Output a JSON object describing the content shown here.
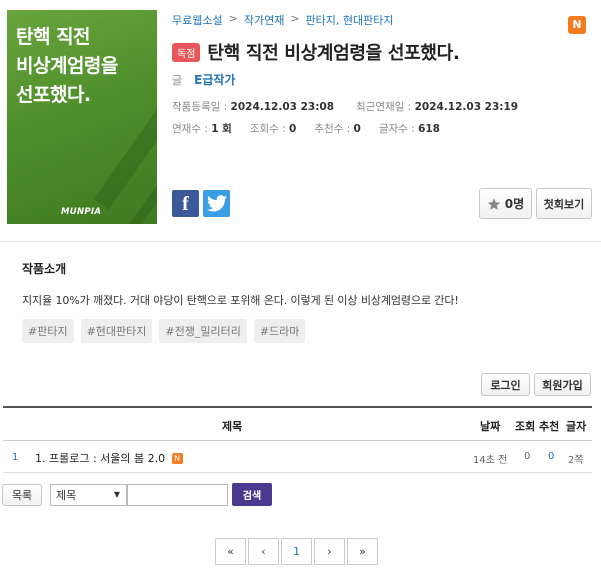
{
  "cover": {
    "title_lines": [
      "탄핵 직전",
      "비상계엄령을",
      "선포했다."
    ],
    "publisher_logo": "MUNPIA"
  },
  "breadcrumb": [
    "무료웹소설",
    "작가연재",
    "판타지, 현대판타지"
  ],
  "separator": ">",
  "new_badge": "N",
  "badge_exclusive": "독점",
  "novel_title": "탄핵 직전 비상계엄령을 선포했다.",
  "author": {
    "label": "글",
    "name": "E급작가"
  },
  "meta": {
    "registered_label": "작품등록일 :",
    "registered_value": "2024.12.03 23:08",
    "latest_label": "최근연재일 :",
    "latest_value": "2024.12.03 23:19",
    "episodes_label": "연재수 :",
    "episodes_value": "1 회",
    "views_label": "조회수 :",
    "views_value": "0",
    "recommend_label": "추천수 :",
    "recommend_value": "0",
    "chars_label": "글자수 :",
    "chars_value": "618"
  },
  "social": {
    "facebook": "f"
  },
  "buttons": {
    "recommend_count": "0명",
    "first_view": "첫회보기",
    "login": "로그인",
    "join": "회원가입",
    "list": "목록",
    "search": "검색"
  },
  "intro": {
    "heading": "작품소개",
    "text": "지지율 10%가 깨졌다. 거대 야당이 탄핵으로 포위해 온다. 이렇게 된 이상 비상계엄령으로 간다!",
    "tags": [
      "#판타지",
      "#현대판타지",
      "#전쟁_밀리터리",
      "#드라마"
    ]
  },
  "table": {
    "headers": {
      "title": "제목",
      "date": "날짜",
      "views": "조회",
      "recommend": "추천",
      "chars": "글자"
    },
    "rows": [
      {
        "num": "1",
        "title": "1. 프롤로그 : 서울의 봄 2.0",
        "badge": "N",
        "date": "14초 전",
        "views": "0",
        "recommend": "0",
        "chars": "2쪽"
      }
    ]
  },
  "search": {
    "select_value": "제목",
    "input_value": ""
  },
  "pager": {
    "first": "«",
    "prev": "‹",
    "current": "1",
    "next": "›",
    "last": "»"
  },
  "colors": {
    "accent_blue": "#1f73b7",
    "badge_red": "#e8585b",
    "new_orange": "#f47b20",
    "search_purple": "#4b3a8f",
    "cover_green": "#4f8f2c"
  }
}
